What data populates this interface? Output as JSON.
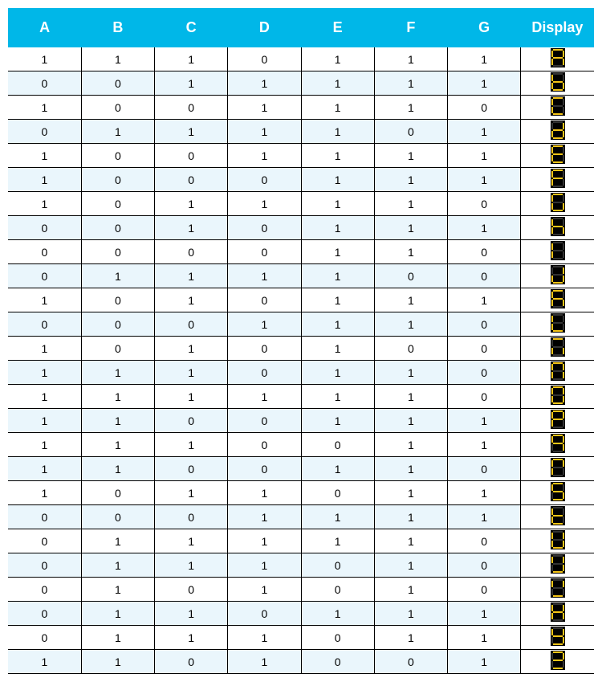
{
  "headers": [
    "A",
    "B",
    "C",
    "D",
    "E",
    "F",
    "G",
    "Display"
  ],
  "rows": [
    {
      "A": 1,
      "B": 1,
      "C": 1,
      "D": 0,
      "E": 1,
      "F": 1,
      "G": 1
    },
    {
      "A": 0,
      "B": 0,
      "C": 1,
      "D": 1,
      "E": 1,
      "F": 1,
      "G": 1
    },
    {
      "A": 1,
      "B": 0,
      "C": 0,
      "D": 1,
      "E": 1,
      "F": 1,
      "G": 0
    },
    {
      "A": 0,
      "B": 1,
      "C": 1,
      "D": 1,
      "E": 1,
      "F": 0,
      "G": 1
    },
    {
      "A": 1,
      "B": 0,
      "C": 0,
      "D": 1,
      "E": 1,
      "F": 1,
      "G": 1
    },
    {
      "A": 1,
      "B": 0,
      "C": 0,
      "D": 0,
      "E": 1,
      "F": 1,
      "G": 1
    },
    {
      "A": 1,
      "B": 0,
      "C": 1,
      "D": 1,
      "E": 1,
      "F": 1,
      "G": 0
    },
    {
      "A": 0,
      "B": 0,
      "C": 1,
      "D": 0,
      "E": 1,
      "F": 1,
      "G": 1
    },
    {
      "A": 0,
      "B": 0,
      "C": 0,
      "D": 0,
      "E": 1,
      "F": 1,
      "G": 0
    },
    {
      "A": 0,
      "B": 1,
      "C": 1,
      "D": 1,
      "E": 1,
      "F": 0,
      "G": 0
    },
    {
      "A": 1,
      "B": 0,
      "C": 1,
      "D": 0,
      "E": 1,
      "F": 1,
      "G": 1
    },
    {
      "A": 0,
      "B": 0,
      "C": 0,
      "D": 1,
      "E": 1,
      "F": 1,
      "G": 0
    },
    {
      "A": 1,
      "B": 0,
      "C": 1,
      "D": 0,
      "E": 1,
      "F": 0,
      "G": 0
    },
    {
      "A": 1,
      "B": 1,
      "C": 1,
      "D": 0,
      "E": 1,
      "F": 1,
      "G": 0
    },
    {
      "A": 1,
      "B": 1,
      "C": 1,
      "D": 1,
      "E": 1,
      "F": 1,
      "G": 0
    },
    {
      "A": 1,
      "B": 1,
      "C": 0,
      "D": 0,
      "E": 1,
      "F": 1,
      "G": 1
    },
    {
      "A": 1,
      "B": 1,
      "C": 1,
      "D": 0,
      "E": 0,
      "F": 1,
      "G": 1
    },
    {
      "A": 1,
      "B": 1,
      "C": 0,
      "D": 0,
      "E": 1,
      "F": 1,
      "G": 0
    },
    {
      "A": 1,
      "B": 0,
      "C": 1,
      "D": 1,
      "E": 0,
      "F": 1,
      "G": 1
    },
    {
      "A": 0,
      "B": 0,
      "C": 0,
      "D": 1,
      "E": 1,
      "F": 1,
      "G": 1
    },
    {
      "A": 0,
      "B": 1,
      "C": 1,
      "D": 1,
      "E": 1,
      "F": 1,
      "G": 0
    },
    {
      "A": 0,
      "B": 1,
      "C": 1,
      "D": 1,
      "E": 0,
      "F": 1,
      "G": 0
    },
    {
      "A": 0,
      "B": 1,
      "C": 0,
      "D": 1,
      "E": 0,
      "F": 1,
      "G": 0
    },
    {
      "A": 0,
      "B": 1,
      "C": 1,
      "D": 0,
      "E": 1,
      "F": 1,
      "G": 1
    },
    {
      "A": 0,
      "B": 1,
      "C": 1,
      "D": 1,
      "E": 0,
      "F": 1,
      "G": 1
    },
    {
      "A": 1,
      "B": 1,
      "C": 0,
      "D": 1,
      "E": 0,
      "F": 0,
      "G": 1
    }
  ]
}
